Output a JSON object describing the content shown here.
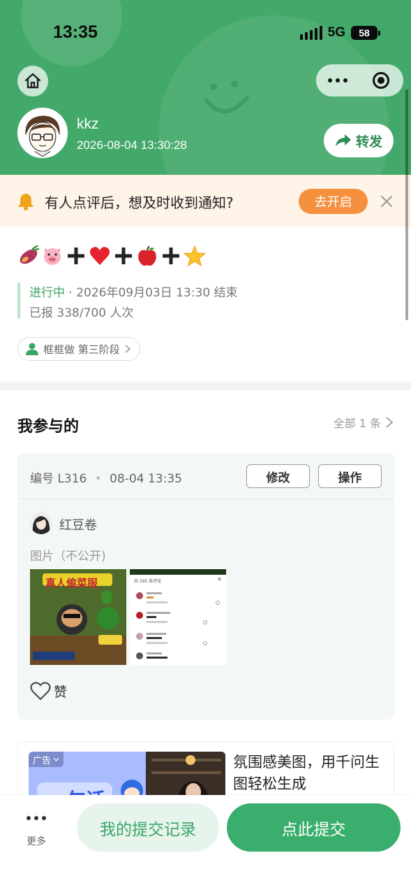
{
  "status_bar": {
    "time": "13:35",
    "network": "5G",
    "battery": "58"
  },
  "header": {
    "username": "kkz",
    "post_time": "2026-08-04 13:30:28",
    "share_label": "转发",
    "icons": {
      "home": "home-icon",
      "more": "more-dots-icon",
      "close": "target-close-icon",
      "share": "share-arrow-icon"
    },
    "colors": {
      "background": "#43a96a",
      "accent_text": "#2e8c56"
    }
  },
  "notice": {
    "text": "有人点评后，想及时收到通知?",
    "button_label": "去开启",
    "colors": {
      "background": "#fdf3e6",
      "button": "#f5913e"
    }
  },
  "activity": {
    "title_emojis": [
      "sweet-potato-emoji",
      "pig-face-emoji",
      "plus-sign",
      "red-heart-emoji",
      "plus-sign",
      "red-apple-emoji",
      "plus-sign",
      "star-emoji"
    ],
    "status": "进行中",
    "end_info": " · 2026年09月03日 13:30 结束",
    "count": "已报 338/700 人次",
    "tag_label": "框框做 第三阶段"
  },
  "participation": {
    "title": "我参与的",
    "all_label": "全部 1 条",
    "entry": {
      "number": "编号 L316",
      "time": "08-04 13:35",
      "edit_label": "修改",
      "operate_label": "操作",
      "member_name": "红豆卷",
      "images_label": "图片（不公开)",
      "like_label": "赞",
      "thumb1_text": "真人偷菜服",
      "thumb2_header": "共 295 条评论"
    }
  },
  "ad": {
    "tag": "广告",
    "text": "氛围感美图，用千问生图轻松生成",
    "image_text": "一句话"
  },
  "bottom_bar": {
    "more_label": "更多",
    "records_label": "我的提交记录",
    "submit_label": "点此提交",
    "colors": {
      "primary": "#3aae6c",
      "secondary_bg": "#e6f4ec"
    }
  }
}
